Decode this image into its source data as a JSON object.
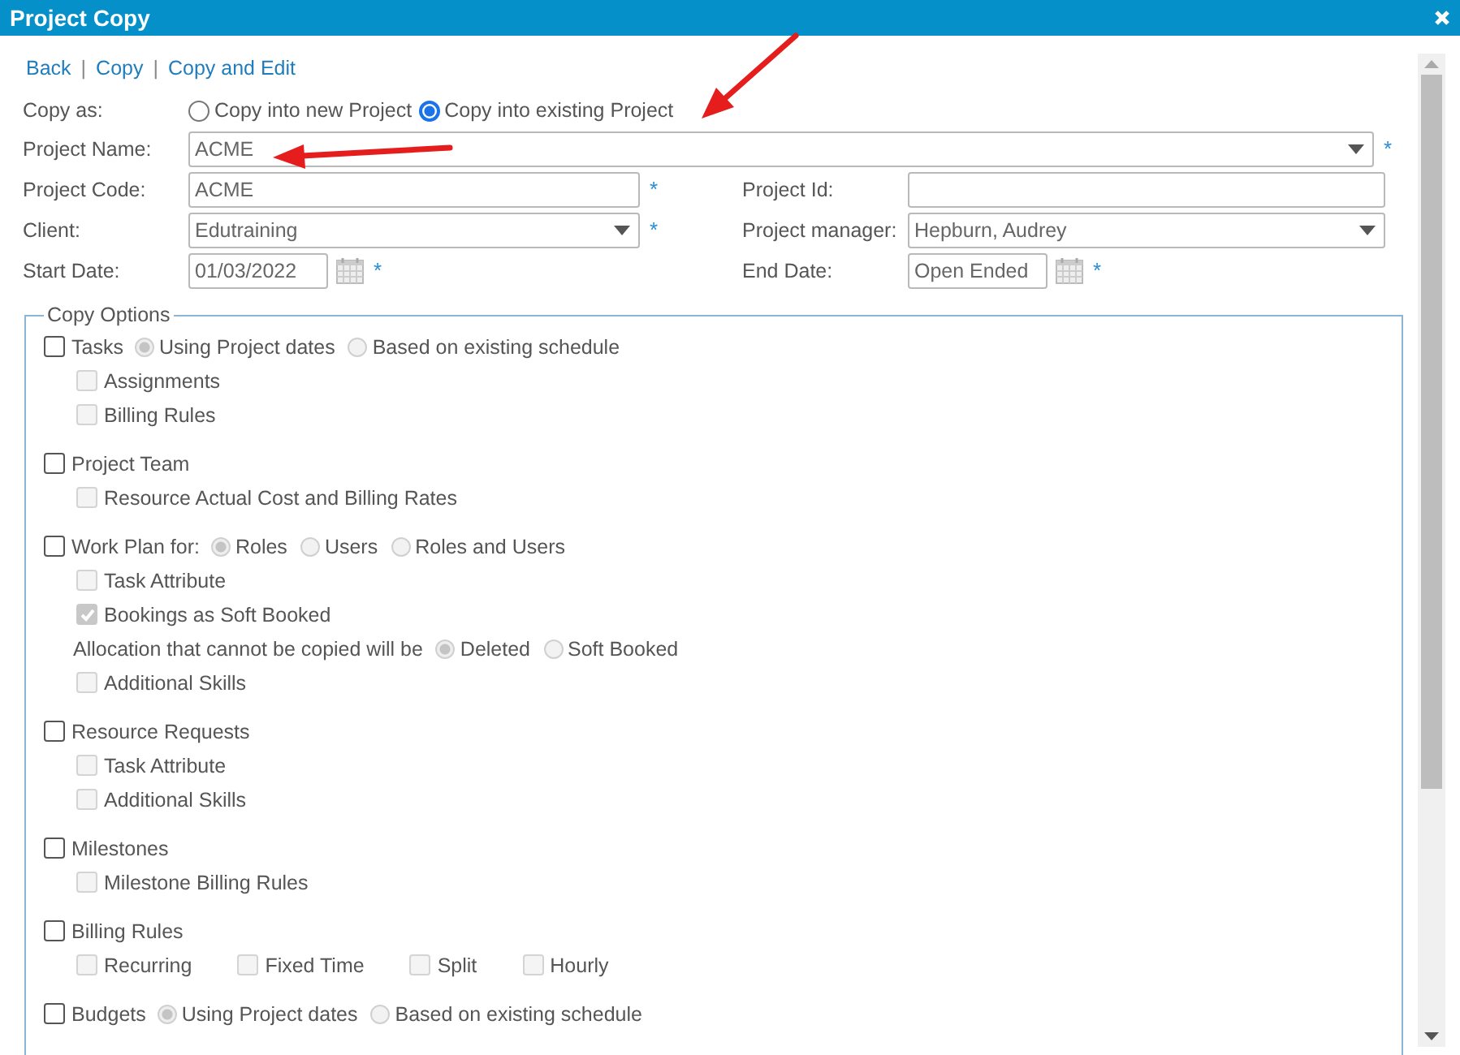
{
  "window": {
    "title": "Project Copy"
  },
  "nav": [
    {
      "kind": "link",
      "text": "Back"
    },
    {
      "kind": "separator",
      "text": "|"
    },
    {
      "kind": "link",
      "text": "Copy"
    },
    {
      "kind": "separator",
      "text": "|"
    },
    {
      "kind": "link",
      "text": "Copy and Edit"
    }
  ],
  "copy_as": {
    "label": "Copy as:",
    "options": [
      {
        "label": "Copy into new Project",
        "selected": false
      },
      {
        "label": "Copy into existing Project",
        "selected": true
      }
    ]
  },
  "form_rows": [
    [
      {
        "label": "Project Name:",
        "kind": "select",
        "value": "ACME",
        "required_mark": "*"
      }
    ],
    [
      {
        "label": "Project Code:",
        "kind": "text",
        "value": "ACME",
        "required_mark": "*"
      },
      {
        "label": "Project Id:",
        "kind": "text"
      }
    ],
    [
      {
        "label": "Client:",
        "kind": "select",
        "value": "Edutraining",
        "required_mark": "*"
      },
      {
        "label": "Project manager:",
        "kind": "select",
        "value": "Hepburn, Audrey"
      }
    ],
    [
      {
        "label": "Start Date:",
        "kind": "date",
        "value": "01/03/2022",
        "required_mark": "*"
      },
      {
        "label": "End Date:",
        "kind": "date",
        "value": "Open Ended",
        "required_mark": "*"
      }
    ]
  ],
  "copy_options": {
    "legend": "Copy Options",
    "groups": [
      {
        "label": "Tasks",
        "checked": false,
        "radios": [
          {
            "label": "Using Project dates",
            "selected": true
          },
          {
            "label": "Based on existing schedule",
            "selected": false
          }
        ],
        "children": [
          {
            "kind": "check",
            "label": "Assignments",
            "checked": false,
            "disabled": true
          },
          {
            "kind": "check",
            "label": "Billing Rules",
            "checked": false,
            "disabled": true
          }
        ]
      },
      {
        "label": "Project Team",
        "checked": false,
        "children": [
          {
            "kind": "check",
            "label": "Resource Actual Cost and Billing Rates",
            "checked": false,
            "disabled": true
          }
        ]
      },
      {
        "label": "Work Plan for:",
        "checked": false,
        "radios": [
          {
            "label": "Roles",
            "selected": true
          },
          {
            "label": "Users",
            "selected": false
          },
          {
            "label": "Roles and Users",
            "selected": false
          }
        ],
        "children": [
          {
            "kind": "check",
            "label": "Task Attribute",
            "checked": false,
            "disabled": true
          },
          {
            "kind": "check",
            "label": "Bookings as Soft Booked",
            "checked": true,
            "disabled": true
          },
          {
            "kind": "radio_line",
            "label": "Allocation that cannot be copied will be",
            "radios": [
              {
                "label": "Deleted",
                "selected": true
              },
              {
                "label": "Soft Booked",
                "selected": false
              }
            ]
          },
          {
            "kind": "check",
            "label": "Additional Skills",
            "checked": false,
            "disabled": true
          }
        ]
      },
      {
        "label": "Resource Requests",
        "checked": false,
        "children": [
          {
            "kind": "check",
            "label": "Task Attribute",
            "checked": false,
            "disabled": true
          },
          {
            "kind": "check",
            "label": "Additional Skills",
            "checked": false,
            "disabled": true
          }
        ]
      },
      {
        "label": "Milestones",
        "checked": false,
        "children": [
          {
            "kind": "check",
            "label": "Milestone Billing Rules",
            "checked": false,
            "disabled": true
          }
        ]
      },
      {
        "label": "Billing Rules",
        "checked": false,
        "children": [
          {
            "kind": "inline_check",
            "label": "Recurring",
            "checked": false,
            "disabled": true
          },
          {
            "kind": "inline_check",
            "label": "Fixed Time",
            "checked": false,
            "disabled": true
          },
          {
            "kind": "inline_check",
            "label": "Split",
            "checked": false,
            "disabled": true
          },
          {
            "kind": "inline_check",
            "label": "Hourly",
            "checked": false,
            "disabled": true
          }
        ]
      },
      {
        "label": "Budgets",
        "checked": false,
        "radios": [
          {
            "label": "Using Project dates",
            "selected": true
          },
          {
            "label": "Based on existing schedule",
            "selected": false
          }
        ]
      }
    ]
  }
}
